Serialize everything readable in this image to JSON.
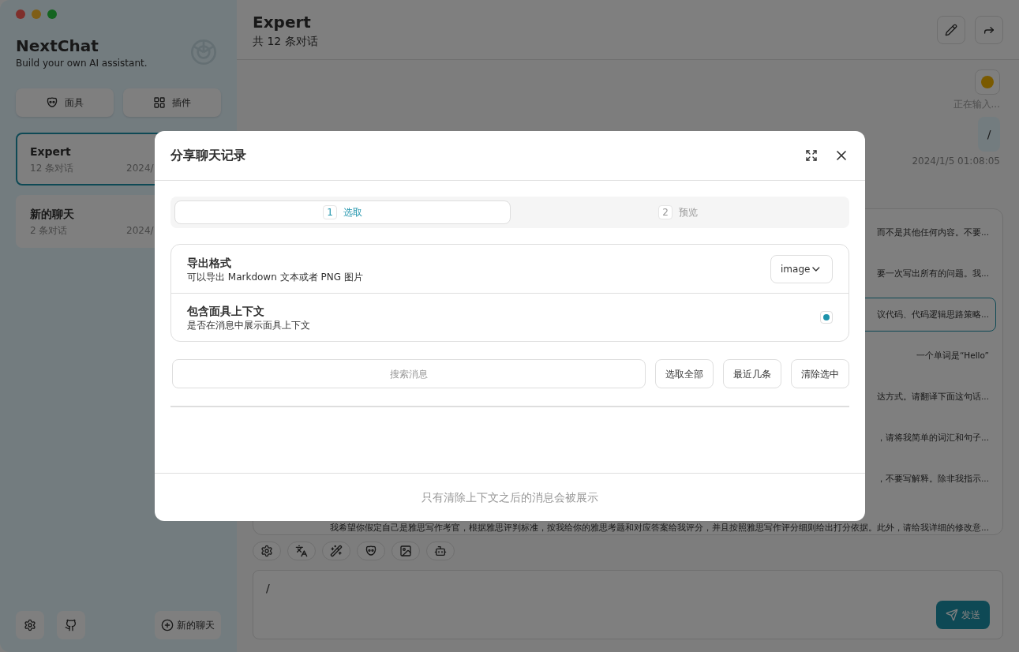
{
  "sidebar": {
    "title": "NextChat",
    "subtitle": "Build your own AI assistant.",
    "buttons": [
      {
        "label": "面具",
        "kind": "mask"
      },
      {
        "label": "插件",
        "kind": "plugins"
      }
    ],
    "chats": [
      {
        "title": "Expert",
        "count": "12 条对话",
        "date": "2024/",
        "selected": true
      },
      {
        "title": "新的聊天",
        "count": "2 条对话",
        "date": "2024/",
        "selected": false
      }
    ],
    "new_chat": "新的聊天"
  },
  "chat": {
    "title": "Expert",
    "subtitle": "共 12 条对话",
    "typing": "正在输入...",
    "user_message": "/",
    "timestamp": "2024/1/5 01:08:05",
    "messages": [
      {
        "text": "而不是其他任何内容。不要...",
        "selected": false
      },
      {
        "text": "要一次写出所有的问题。我...",
        "selected": false
      },
      {
        "text": "议代码、代码逻辑思路策略...",
        "selected": true
      },
      {
        "text": "一个单词是“Hello”",
        "selected": false
      },
      {
        "text": "达方式。请翻译下面这句话...",
        "selected": false
      },
      {
        "text": "，请将我简单的词汇和句子...",
        "selected": false
      },
      {
        "text": "，不要写解释。除非我指示...",
        "selected": false
      },
      {
        "text": "我希望你假定自己是雅思写作考官，根据雅思评判标准，按我给你的雅思考题和对应答案给我评分，并且按照雅思写作评分细则给出打分依据。此外，请给我详细的修改意...",
        "selected": false
      }
    ],
    "input_value": "/",
    "send": "发送"
  },
  "dialog": {
    "title": "分享聊天记录",
    "steps": [
      {
        "number": "1",
        "label": "选取",
        "selected": true
      },
      {
        "number": "2",
        "label": "预览",
        "selected": false
      }
    ],
    "options": [
      {
        "kind": "select",
        "title": "导出格式",
        "description": "可以导出 Markdown 文本或者 PNG 图片",
        "value": "image"
      },
      {
        "kind": "checkbox",
        "title": "包含面具上下文",
        "description": "是否在消息中展示面具上下文",
        "checked": true
      }
    ],
    "search_placeholder": "搜索消息",
    "actions": [
      "选取全部",
      "最近几条",
      "清除选中"
    ],
    "footer": "只有清除上下文之后的消息会被展示"
  }
}
